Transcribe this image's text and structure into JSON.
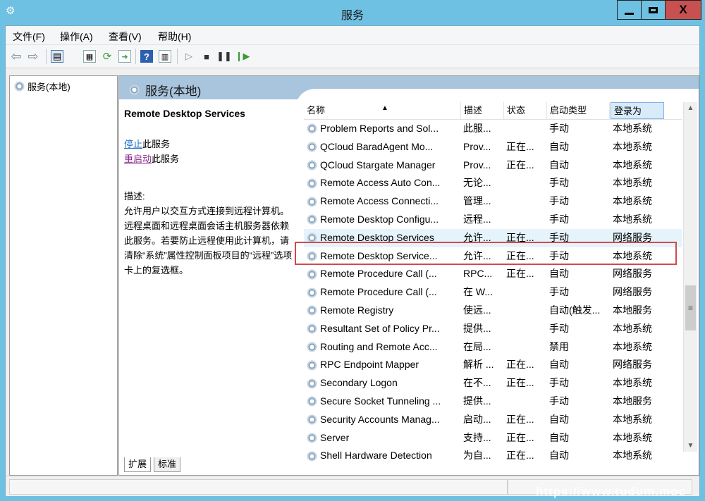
{
  "window": {
    "title": "服务",
    "icon": "gear-icon",
    "minimize_icon": "minimize-icon",
    "maximize_icon": "maximize-icon",
    "close_icon": "close-icon",
    "close_label": "X"
  },
  "menubar": [
    {
      "label": "文件(F)"
    },
    {
      "label": "操作(A)"
    },
    {
      "label": "查看(V)"
    },
    {
      "label": "帮助(H)"
    }
  ],
  "toolbar": {
    "icons": [
      "back-arrow-icon",
      "forward-arrow-icon",
      "console-tree-icon",
      "properties-icon",
      "refresh-icon",
      "export-list-icon",
      "help-icon",
      "show-hide-pane-icon",
      "start-service-icon",
      "stop-service-icon",
      "pause-service-icon",
      "resume-service-icon"
    ]
  },
  "tree": {
    "root_label": "服务(本地)"
  },
  "content": {
    "title": "服务(本地)",
    "selected_service": "Remote Desktop Services",
    "stop_link": "停止",
    "stop_suffix": "此服务",
    "restart_link": "重启动",
    "restart_suffix": "此服务",
    "desc_label": "描述:",
    "description": "允许用户以交互方式连接到远程计算机。远程桌面和远程桌面会话主机服务器依赖此服务。若要防止远程使用此计算机，请清除“系统”属性控制面板项目的“远程”选项卡上的复选框。"
  },
  "list": {
    "columns": [
      "名称",
      "描述",
      "状态",
      "启动类型",
      "登录为"
    ],
    "sort_indicator": "▲",
    "rows": [
      {
        "name": "Problem Reports and Sol...",
        "desc": "此服...",
        "status": "",
        "startup": "手动",
        "logon": "本地系统"
      },
      {
        "name": "QCloud BaradAgent Mo...",
        "desc": "Prov...",
        "status": "正在...",
        "startup": "自动",
        "logon": "本地系统"
      },
      {
        "name": "QCloud Stargate Manager",
        "desc": "Prov...",
        "status": "正在...",
        "startup": "自动",
        "logon": "本地系统"
      },
      {
        "name": "Remote Access Auto Con...",
        "desc": "无论...",
        "status": "",
        "startup": "手动",
        "logon": "本地系统"
      },
      {
        "name": "Remote Access Connecti...",
        "desc": "管理...",
        "status": "",
        "startup": "手动",
        "logon": "本地系统"
      },
      {
        "name": "Remote Desktop Configu...",
        "desc": "远程...",
        "status": "",
        "startup": "手动",
        "logon": "本地系统"
      },
      {
        "name": "Remote Desktop Services",
        "desc": "允许...",
        "status": "正在...",
        "startup": "手动",
        "logon": "网络服务"
      },
      {
        "name": "Remote Desktop Service...",
        "desc": "允许...",
        "status": "正在...",
        "startup": "手动",
        "logon": "本地系统"
      },
      {
        "name": "Remote Procedure Call (...",
        "desc": "RPC...",
        "status": "正在...",
        "startup": "自动",
        "logon": "网络服务"
      },
      {
        "name": "Remote Procedure Call (...",
        "desc": "在 W...",
        "status": "",
        "startup": "手动",
        "logon": "网络服务"
      },
      {
        "name": "Remote Registry",
        "desc": "使远...",
        "status": "",
        "startup": "自动(触发...",
        "logon": "本地服务"
      },
      {
        "name": "Resultant Set of Policy Pr...",
        "desc": "提供...",
        "status": "",
        "startup": "手动",
        "logon": "本地系统"
      },
      {
        "name": "Routing and Remote Acc...",
        "desc": "在局...",
        "status": "",
        "startup": "禁用",
        "logon": "本地系统"
      },
      {
        "name": "RPC Endpoint Mapper",
        "desc": "解析 ...",
        "status": "正在...",
        "startup": "自动",
        "logon": "网络服务"
      },
      {
        "name": "Secondary Logon",
        "desc": "在不...",
        "status": "正在...",
        "startup": "手动",
        "logon": "本地系统"
      },
      {
        "name": "Secure Socket Tunneling ...",
        "desc": "提供...",
        "status": "",
        "startup": "手动",
        "logon": "本地服务"
      },
      {
        "name": "Security Accounts Manag...",
        "desc": "启动...",
        "status": "正在...",
        "startup": "自动",
        "logon": "本地系统"
      },
      {
        "name": "Server",
        "desc": "支持...",
        "status": "正在...",
        "startup": "自动",
        "logon": "本地系统"
      },
      {
        "name": "Shell Hardware Detection",
        "desc": "为自...",
        "status": "正在...",
        "startup": "自动",
        "logon": "本地系统"
      }
    ]
  },
  "tabs": [
    {
      "label": "扩展"
    },
    {
      "label": "标准"
    }
  ],
  "colors": {
    "title_bar": "#6fc1e3",
    "close_button": "#c75050",
    "selection_box": "#d24a4a",
    "header_band": "#a9c4dd",
    "link": "#1c6fc4"
  },
  "watermark": "https://www.tudum.moc"
}
